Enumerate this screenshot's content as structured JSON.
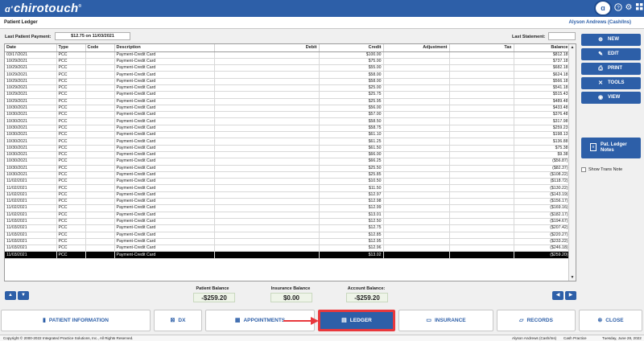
{
  "app": {
    "logo_text": "chirotouch",
    "logo_mark": "ɑ'",
    "window_title": "Patient Ledger",
    "user_name": "Alyson Andrews (Cash/Ins)"
  },
  "ledger": {
    "last_payment_label": "Last Patient Payment:",
    "last_payment_value": "$12.75 on 11/03/2021",
    "last_statement_label": "Last Statement:",
    "last_statement_value": "",
    "columns": [
      "Date",
      "Type",
      "Code",
      "Description",
      "Debit",
      "Credit",
      "Adjustment",
      "Tax",
      "Balance"
    ],
    "rows": [
      [
        "03/17/2021",
        "PCC",
        "",
        "Payment-Credit Card",
        "",
        "$100.00",
        "",
        "",
        "$812.18"
      ],
      [
        "10/29/2021",
        "PCC",
        "",
        "Payment-Credit Card",
        "",
        "$75.00",
        "",
        "",
        "$737.18"
      ],
      [
        "10/29/2021",
        "PCC",
        "",
        "Payment-Credit Card",
        "",
        "$55.00",
        "",
        "",
        "$682.18"
      ],
      [
        "10/29/2021",
        "PCC",
        "",
        "Payment-Credit Card",
        "",
        "$58.00",
        "",
        "",
        "$624.18"
      ],
      [
        "10/29/2021",
        "PCC",
        "",
        "Payment-Credit Card",
        "",
        "$58.00",
        "",
        "",
        "$566.18"
      ],
      [
        "10/29/2021",
        "PCC",
        "",
        "Payment-Credit Card",
        "",
        "$25.00",
        "",
        "",
        "$541.18"
      ],
      [
        "10/29/2021",
        "PCC",
        "",
        "Payment-Credit Card",
        "",
        "$25.75",
        "",
        "",
        "$515.43"
      ],
      [
        "10/29/2021",
        "PCC",
        "",
        "Payment-Credit Card",
        "",
        "$25.95",
        "",
        "",
        "$489.48"
      ],
      [
        "10/30/2021",
        "PCC",
        "",
        "Payment-Credit Card",
        "",
        "$56.00",
        "",
        "",
        "$433.48"
      ],
      [
        "10/30/2021",
        "PCC",
        "",
        "Payment-Credit Card",
        "",
        "$57.00",
        "",
        "",
        "$376.48"
      ],
      [
        "10/30/2021",
        "PCC",
        "",
        "Payment-Credit Card",
        "",
        "$58.50",
        "",
        "",
        "$317.98"
      ],
      [
        "10/30/2021",
        "PCC",
        "",
        "Payment-Credit Card",
        "",
        "$58.75",
        "",
        "",
        "$259.23"
      ],
      [
        "10/30/2021",
        "PCC",
        "",
        "Payment-Credit Card",
        "",
        "$61.10",
        "",
        "",
        "$198.13"
      ],
      [
        "10/30/2021",
        "PCC",
        "",
        "Payment-Credit Card",
        "",
        "$61.25",
        "",
        "",
        "$136.88"
      ],
      [
        "10/30/2021",
        "PCC",
        "",
        "Payment-Credit Card",
        "",
        "$61.50",
        "",
        "",
        "$75.38"
      ],
      [
        "10/30/2021",
        "PCC",
        "",
        "Payment-Credit Card",
        "",
        "$66.00",
        "",
        "",
        "$9.38"
      ],
      [
        "10/30/2021",
        "PCC",
        "",
        "Payment-Credit Card",
        "",
        "$66.25",
        "",
        "",
        "($56.87)"
      ],
      [
        "10/30/2021",
        "PCC",
        "",
        "Payment-Credit Card",
        "",
        "$25.50",
        "",
        "",
        "($82.37)"
      ],
      [
        "10/30/2021",
        "PCC",
        "",
        "Payment-Credit Card",
        "",
        "$25.85",
        "",
        "",
        "($108.22)"
      ],
      [
        "11/02/2021",
        "PCC",
        "",
        "Payment-Credit Card",
        "",
        "$10.50",
        "",
        "",
        "($118.72)"
      ],
      [
        "11/02/2021",
        "PCC",
        "",
        "Payment-Credit Card",
        "",
        "$11.50",
        "",
        "",
        "($130.22)"
      ],
      [
        "11/02/2021",
        "PCC",
        "",
        "Payment-Credit Card",
        "",
        "$12.97",
        "",
        "",
        "($143.19)"
      ],
      [
        "11/02/2021",
        "PCC",
        "",
        "Payment-Credit Card",
        "",
        "$12.98",
        "",
        "",
        "($156.17)"
      ],
      [
        "11/02/2021",
        "PCC",
        "",
        "Payment-Credit Card",
        "",
        "$12.99",
        "",
        "",
        "($169.16)"
      ],
      [
        "11/02/2021",
        "PCC",
        "",
        "Payment-Credit Card",
        "",
        "$13.01",
        "",
        "",
        "($182.17)"
      ],
      [
        "11/03/2021",
        "PCC",
        "",
        "Payment-Credit Card",
        "",
        "$12.50",
        "",
        "",
        "($194.67)"
      ],
      [
        "11/03/2021",
        "PCC",
        "",
        "Payment-Credit Card",
        "",
        "$12.75",
        "",
        "",
        "($207.42)"
      ],
      [
        "11/03/2021",
        "PCC",
        "",
        "Payment-Credit Card",
        "",
        "$12.85",
        "",
        "",
        "($220.27)"
      ],
      [
        "11/03/2021",
        "PCC",
        "",
        "Payment-Credit Card",
        "",
        "$12.95",
        "",
        "",
        "($233.22)"
      ],
      [
        "11/03/2021",
        "PCC",
        "",
        "Payment-Credit Card",
        "",
        "$12.96",
        "",
        "",
        "($246.18)"
      ],
      [
        "11/03/2021",
        "PCC",
        "",
        "Payment-Credit Card",
        "",
        "$13.02",
        "",
        "",
        "($259.20)"
      ]
    ],
    "selected_row_index": 30
  },
  "balances": {
    "patient_label": "Patient Balance",
    "patient_value": "-$259.20",
    "insurance_label": "Insurance Balance",
    "insurance_value": "$0.00",
    "account_label": "Account Balance:",
    "account_value": "-$259.20"
  },
  "side_buttons": {
    "new": "NEW",
    "edit": "EDIT",
    "print": "PRINT",
    "tools": "TOOLS",
    "view": "VIEW",
    "notes": "Pat. Ledger Notes",
    "show_trans_note": "Show Trans Note"
  },
  "bottom_nav": {
    "patient_information": "PATIENT INFORMATION",
    "dx": "DX",
    "appointments": "APPOINTMENTS",
    "ledger": "LEDGER",
    "insurance": "INSURANCE",
    "records": "RECORDS",
    "close": "CLOSE"
  },
  "status": {
    "copyright": "Copyright © 2000-2022 Integrated Practice Solutions, Inc., All Rights Reserved.",
    "user": "Alyson Andrews (Cash/Ins)",
    "practice": "Cash Practice",
    "date": "Tuesday, June 28, 2022"
  },
  "colors": {
    "brand_blue": "#2d5fa8",
    "highlight_red": "#e8383d"
  }
}
